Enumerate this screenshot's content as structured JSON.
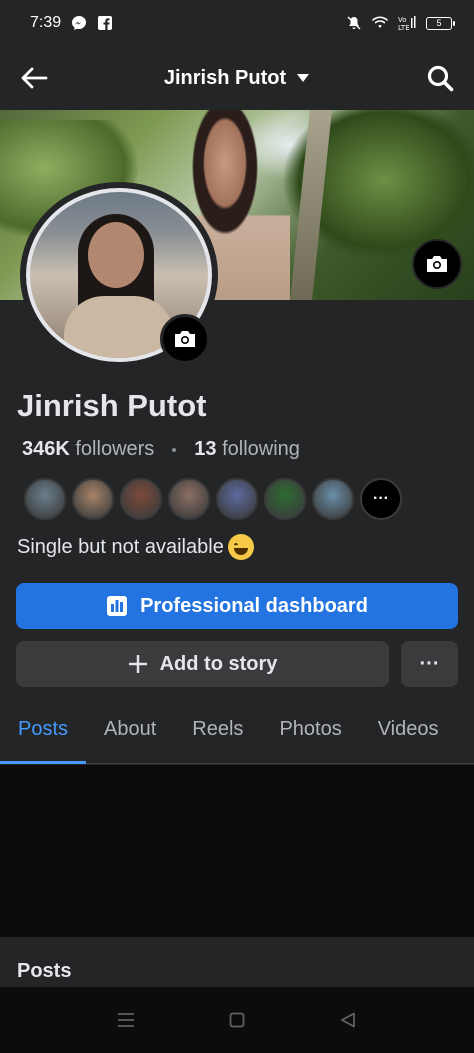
{
  "status_bar": {
    "time": "7:39",
    "battery": "5"
  },
  "header": {
    "title": "Jinrish Putot"
  },
  "profile": {
    "name": "Jinrish Putot",
    "followers_count": "346K",
    "followers_label": "followers",
    "following_count": "13",
    "following_label": "following",
    "bio": "Single but not available",
    "follower_avatars": [
      {
        "color": "#6b7f8c"
      },
      {
        "color": "#a88468"
      },
      {
        "color": "#7b4a3a"
      },
      {
        "color": "#8c6f62"
      },
      {
        "color": "#5d6a9e"
      },
      {
        "color": "#2f6b32"
      },
      {
        "color": "#6b8fa8"
      }
    ],
    "more_followers": "···"
  },
  "actions": {
    "professional_dashboard": "Professional dashboard",
    "add_to_story": "Add to story",
    "more": "···"
  },
  "tabs": [
    {
      "label": "Posts",
      "active": true
    },
    {
      "label": "About"
    },
    {
      "label": "Reels"
    },
    {
      "label": "Photos"
    },
    {
      "label": "Videos"
    }
  ],
  "posts_section": {
    "title": "Posts"
  },
  "colors": {
    "accent": "#2374e1",
    "tab_active": "#4599ff",
    "background": "#242526"
  }
}
